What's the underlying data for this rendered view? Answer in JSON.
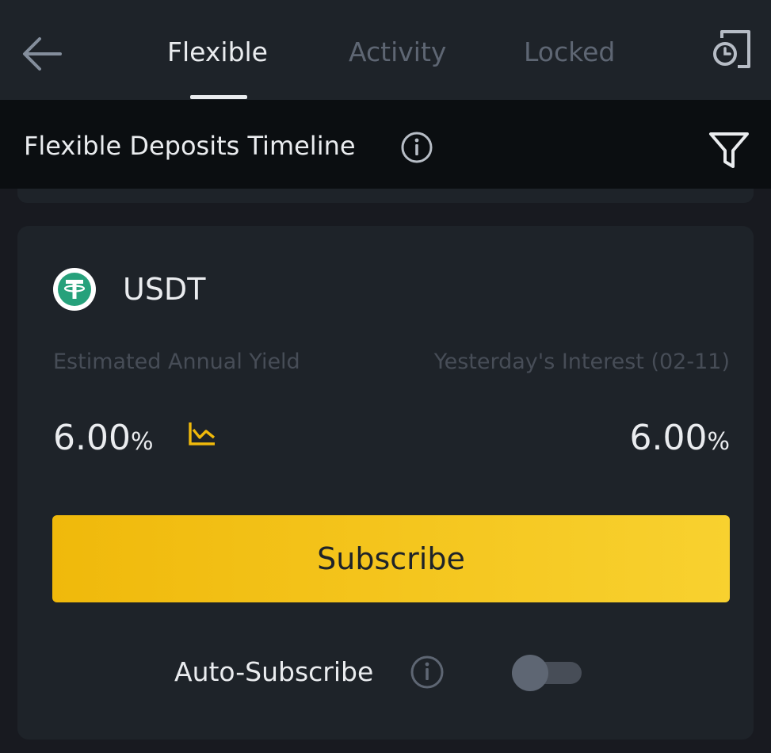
{
  "nav": {
    "tabs": [
      {
        "label": "Flexible",
        "active": true
      },
      {
        "label": "Activity",
        "active": false
      },
      {
        "label": "Locked",
        "active": false
      }
    ],
    "back_icon": "arrow-left-icon",
    "history_icon": "history-clock-icon"
  },
  "timeline": {
    "title": "Flexible Deposits Timeline",
    "info_icon": "info-icon",
    "filter_icon": "filter-icon"
  },
  "product": {
    "coin": "USDT",
    "coin_icon": "tether-logo",
    "estimated_yield_label": "Estimated Annual Yield",
    "estimated_yield_value": "6.00",
    "estimated_yield_unit": "%",
    "yesterday_label": "Yesterday's Interest (02-11)",
    "yesterday_value": "6.00",
    "yesterday_unit": "%",
    "chart_icon": "trend-chart-icon",
    "subscribe_label": "Subscribe",
    "auto_subscribe_label": "Auto-Subscribe",
    "auto_subscribe_on": false
  },
  "colors": {
    "background": "#181a20",
    "surface": "#1e2329",
    "accent": "#f0b90b",
    "tether_green": "#26a17b"
  }
}
